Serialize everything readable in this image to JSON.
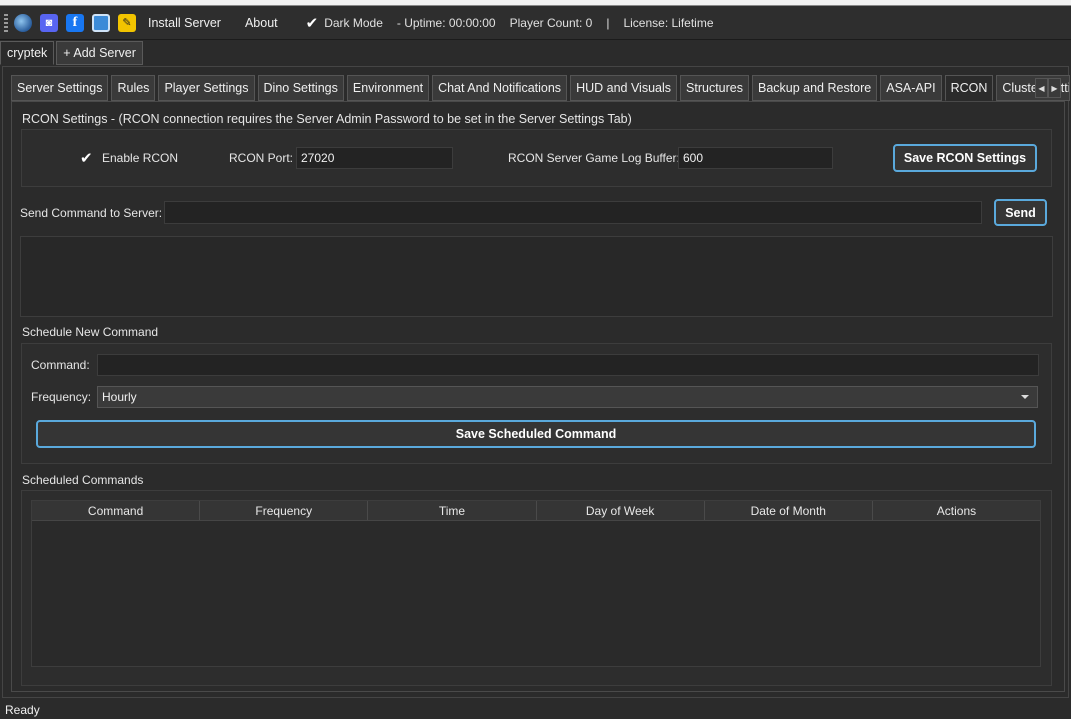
{
  "toolbar": {
    "icons": [
      "globe-icon",
      "discord-icon",
      "facebook-icon",
      "save-icon",
      "edit-icon"
    ],
    "install_server": "Install Server",
    "about": "About",
    "dark_mode": "Dark Mode",
    "uptime": "- Uptime: 00:00:00",
    "player_count": "Player Count: 0",
    "separator": "|",
    "license": "License: Lifetime"
  },
  "server_tabs": [
    "cryptek",
    "+ Add Server"
  ],
  "tabs": [
    "Server Settings",
    "Rules",
    "Player Settings",
    "Dino Settings",
    "Environment",
    "Chat And Notifications",
    "HUD and Visuals",
    "Structures",
    "Backup and Restore",
    "ASA-API",
    "RCON",
    "Cluster Setti"
  ],
  "active_tab": "RCON",
  "rcon": {
    "heading": "RCON Settings - (RCON connection requires the Server Admin Password to be set in the Server Settings Tab)",
    "enable_label": "Enable RCON",
    "port_label": "RCON Port:",
    "port_value": "27020",
    "buffer_label": "RCON Server Game Log Buffer:",
    "buffer_value": "600",
    "save_button": "Save RCON Settings"
  },
  "send": {
    "label": "Send Command to Server:",
    "value": "",
    "button": "Send"
  },
  "schedule": {
    "heading": "Schedule New Command",
    "command_label": "Command:",
    "command_value": "",
    "frequency_label": "Frequency:",
    "frequency_value": "Hourly",
    "save_button": "Save Scheduled Command"
  },
  "scheduled": {
    "heading": "Scheduled Commands",
    "columns": [
      "Command",
      "Frequency",
      "Time",
      "Day of Week",
      "Date of Month",
      "Actions"
    ]
  },
  "status": "Ready",
  "colors": {
    "accent": "#5aa9dc",
    "background": "#2b2b2b"
  }
}
